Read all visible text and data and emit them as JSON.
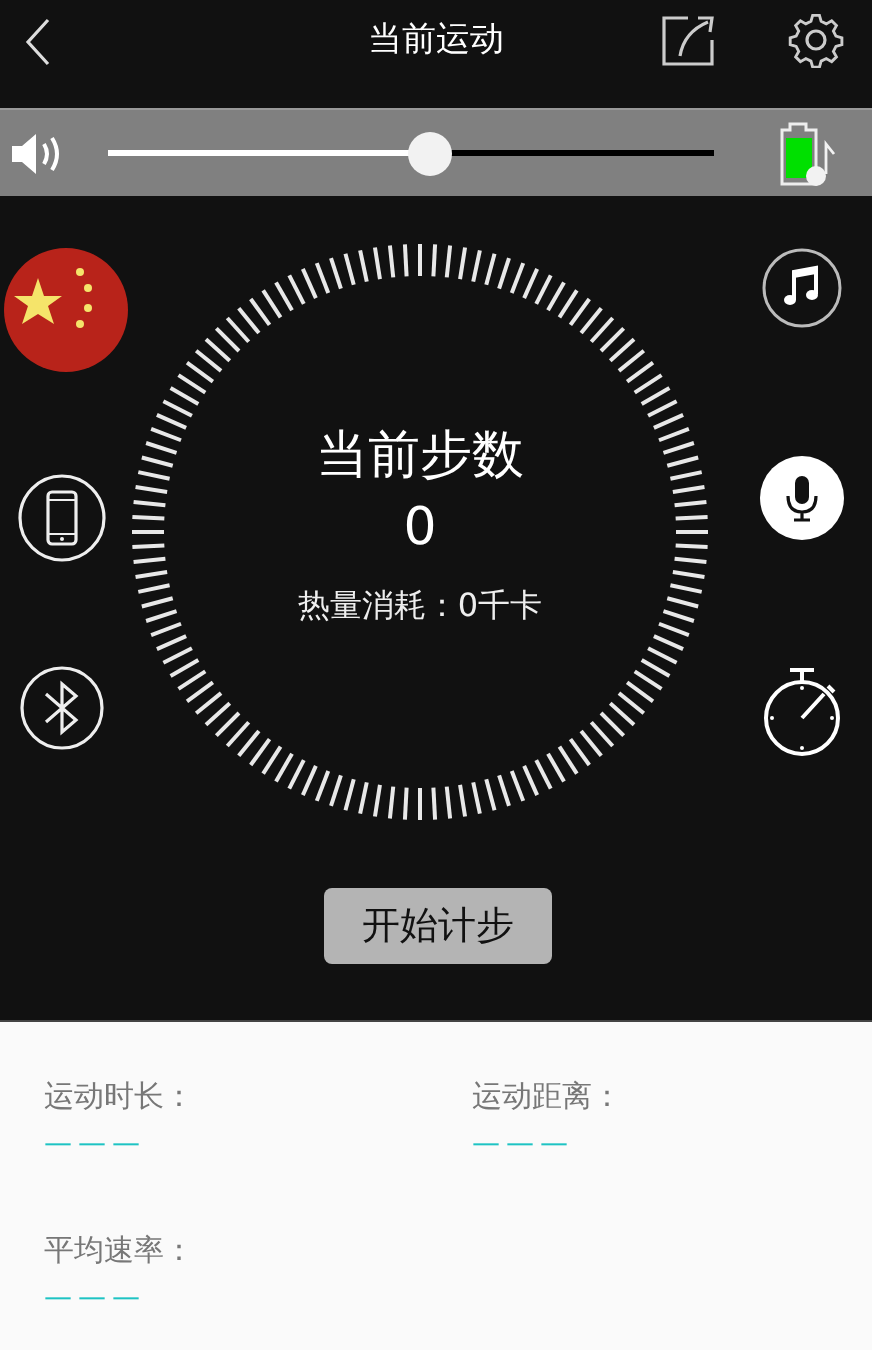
{
  "header": {
    "title": "当前运动"
  },
  "volume": {
    "level": 0.53
  },
  "dial": {
    "title": "当前步数",
    "steps": "0",
    "calories": "热量消耗：0千卡"
  },
  "start_button": {
    "label": "开始计步"
  },
  "stats": [
    {
      "label": "运动时长：",
      "value": "———"
    },
    {
      "label": "运动距离：",
      "value": "———"
    },
    {
      "label": "平均速率：",
      "value": "———"
    }
  ]
}
